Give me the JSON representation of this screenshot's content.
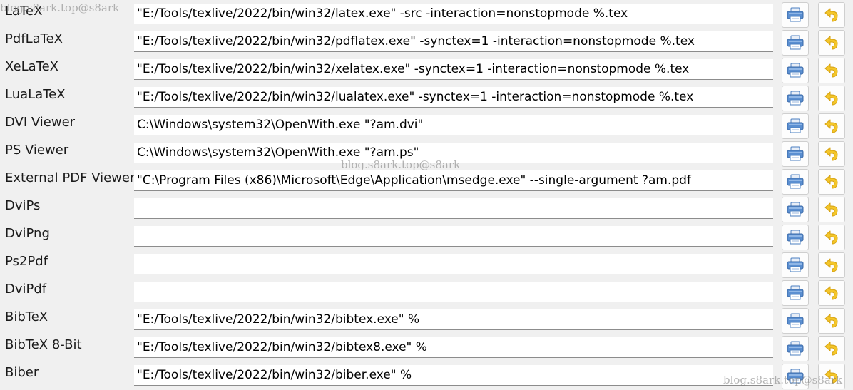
{
  "commands": [
    {
      "label": "LaTeX",
      "value": "\"E:/Tools/texlive/2022/bin/win32/latex.exe\" -src -interaction=nonstopmode %.tex"
    },
    {
      "label": "PdfLaTeX",
      "value": "\"E:/Tools/texlive/2022/bin/win32/pdflatex.exe\" -synctex=1 -interaction=nonstopmode %.tex"
    },
    {
      "label": "XeLaTeX",
      "value": "\"E:/Tools/texlive/2022/bin/win32/xelatex.exe\" -synctex=1 -interaction=nonstopmode %.tex"
    },
    {
      "label": "LuaLaTeX",
      "value": "\"E:/Tools/texlive/2022/bin/win32/lualatex.exe\" -synctex=1 -interaction=nonstopmode %.tex"
    },
    {
      "label": "DVI Viewer",
      "value": "C:\\Windows\\system32\\OpenWith.exe \"?am.dvi\""
    },
    {
      "label": "PS Viewer",
      "value": "C:\\Windows\\system32\\OpenWith.exe \"?am.ps\""
    },
    {
      "label": "External PDF Viewer",
      "value": "\"C:\\Program Files (x86)\\Microsoft\\Edge\\Application\\msedge.exe\" --single-argument ?am.pdf"
    },
    {
      "label": "DviPs",
      "value": ""
    },
    {
      "label": "DviPng",
      "value": ""
    },
    {
      "label": "Ps2Pdf",
      "value": ""
    },
    {
      "label": "DviPdf",
      "value": ""
    },
    {
      "label": "BibTeX",
      "value": "\"E:/Tools/texlive/2022/bin/win32/bibtex.exe\" %"
    },
    {
      "label": "BibTeX 8-Bit",
      "value": "\"E:/Tools/texlive/2022/bin/win32/bibtex8.exe\" %"
    },
    {
      "label": "Biber",
      "value": "\"E:/Tools/texlive/2022/bin/win32/biber.exe\" %"
    }
  ],
  "icons": {
    "select_button": "printer-icon",
    "reset_button": "undo-arrow-icon"
  },
  "colors": {
    "window_bg": "#f0f0f0",
    "input_bg": "#ffffff",
    "icon_blue": "#4a7fc1",
    "icon_yellow": "#f2c21b"
  },
  "watermark": "blog.s8ark.top@s8ark"
}
